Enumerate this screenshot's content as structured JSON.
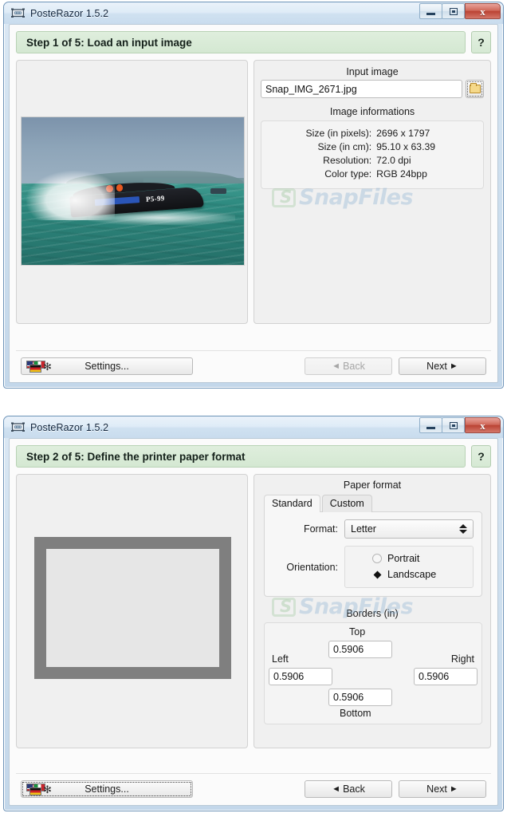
{
  "window1": {
    "title": "PosteRazor 1.5.2",
    "icon": "app-icon",
    "controls": {
      "minimize": "minimize-icon",
      "maximize": "maximize-icon",
      "close": "close-icon"
    },
    "step": {
      "label": "Step 1 of 5: Load an input image",
      "help": "?"
    },
    "right": {
      "input_image_label": "Input image",
      "file_value": "Snap_IMG_2671.jpg",
      "browse_icon": "folder-icon",
      "image_info_label": "Image informations",
      "info": [
        {
          "key": "Size (in pixels):",
          "value": "2696 x 1797"
        },
        {
          "key": "Size (in cm):",
          "value": "95.10 x 63.39"
        },
        {
          "key": "Resolution:",
          "value": "72.0 dpi"
        },
        {
          "key": "Color type:",
          "value": "RGB 24bpp"
        }
      ]
    },
    "buttons": {
      "settings": "Settings...",
      "back": "Back",
      "next": "Next",
      "back_enabled": false
    },
    "watermark": "SnapFiles"
  },
  "window2": {
    "title": "PosteRazor 1.5.2",
    "icon": "app-icon",
    "controls": {
      "minimize": "minimize-icon",
      "maximize": "maximize-icon",
      "close": "close-icon"
    },
    "step": {
      "label": "Step 2 of 5: Define the printer paper format",
      "help": "?"
    },
    "right": {
      "paper_format_label": "Paper format",
      "tabs": [
        {
          "label": "Standard",
          "active": true
        },
        {
          "label": "Custom",
          "active": false
        }
      ],
      "format_label": "Format:",
      "format_value": "Letter",
      "orientation_label": "Orientation:",
      "orientation_options": [
        {
          "label": "Portrait",
          "selected": false
        },
        {
          "label": "Landscape",
          "selected": true
        }
      ],
      "borders_label": "Borders (in)",
      "borders": {
        "top_label": "Top",
        "top_value": "0.5906",
        "left_label": "Left",
        "left_value": "0.5906",
        "right_label": "Right",
        "right_value": "0.5906",
        "bottom_label": "Bottom",
        "bottom_value": "0.5906"
      }
    },
    "buttons": {
      "settings": "Settings...",
      "back": "Back",
      "next": "Next",
      "back_enabled": true
    },
    "watermark": "SnapFiles"
  },
  "colors": {
    "step_bar": "#d8ead6",
    "title_bar": "#d9e8f4",
    "close_button": "#bb4334",
    "paper_border": "#7f7f7f",
    "paper_fill": "#e6e6e6",
    "watermark": "#78a5cd"
  }
}
